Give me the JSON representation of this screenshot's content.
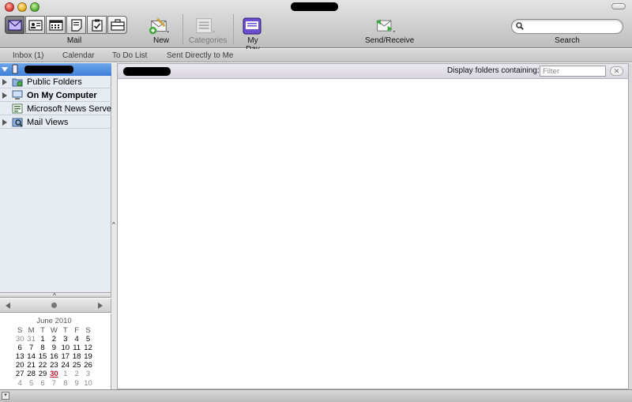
{
  "toolbar": {
    "mail_label": "Mail",
    "new_label": "New",
    "categories_label": "Categories",
    "myday_label": "My Day",
    "sendreceive_label": "Send/Receive",
    "search_label": "Search",
    "search_placeholder": ""
  },
  "favorites": {
    "items": [
      "Inbox (1)",
      "Calendar",
      "To Do List",
      "Sent Directly to Me"
    ]
  },
  "folders": {
    "items": [
      {
        "label": "Public Folders",
        "icon": "public-folders-icon"
      },
      {
        "label": "On My Computer",
        "icon": "computer-icon"
      },
      {
        "label": "Microsoft News Server",
        "icon": "news-server-icon"
      },
      {
        "label": "Mail Views",
        "icon": "mail-views-icon"
      }
    ]
  },
  "main": {
    "filter_label": "Display folders containing:",
    "filter_placeholder": "Filter"
  },
  "calendar": {
    "title": "June 2010",
    "weekdays": [
      "S",
      "M",
      "T",
      "W",
      "T",
      "F",
      "S"
    ],
    "weeks": [
      [
        "30",
        "31",
        "1",
        "2",
        "3",
        "4",
        "5"
      ],
      [
        "6",
        "7",
        "8",
        "9",
        "10",
        "11",
        "12"
      ],
      [
        "13",
        "14",
        "15",
        "16",
        "17",
        "18",
        "19"
      ],
      [
        "20",
        "21",
        "22",
        "23",
        "24",
        "25",
        "26"
      ],
      [
        "27",
        "28",
        "29",
        "30",
        "1",
        "2",
        "3"
      ],
      [
        "4",
        "5",
        "6",
        "7",
        "8",
        "9",
        "10"
      ]
    ],
    "today": "30"
  },
  "colors": {
    "selection": "#3e7fd9",
    "accent_purple": "#6b4fcf",
    "today_red": "#c4112d"
  }
}
